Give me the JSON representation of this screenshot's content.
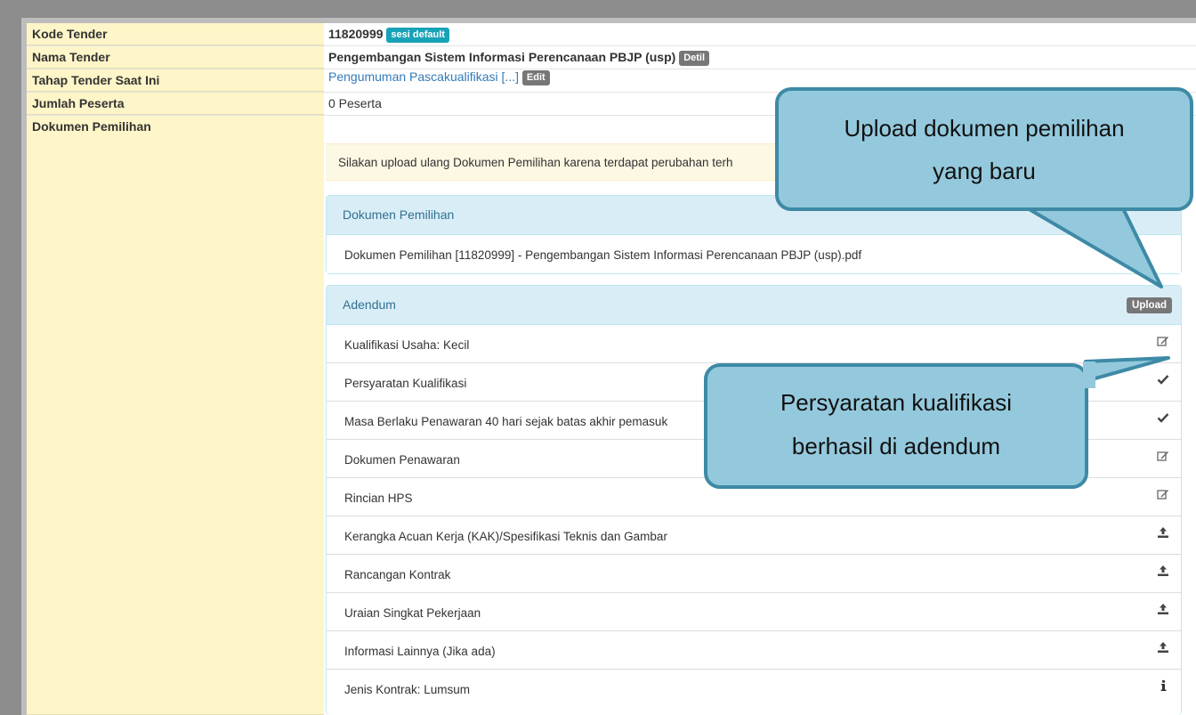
{
  "fields": {
    "kode_label": "Kode Tender",
    "kode_value": "11820999",
    "kode_badge": "sesi default",
    "nama_label": "Nama Tender",
    "nama_value": "Pengembangan Sistem Informasi Perencanaan PBJP (usp)",
    "nama_badge": "Detil",
    "tahap_label": "Tahap Tender Saat Ini",
    "tahap_value": "Pengumuman Pascakualifikasi [...]",
    "tahap_badge": "Edit",
    "jumlah_label": "Jumlah Peserta",
    "jumlah_value": "0 Peserta",
    "dokumen_label": "Dokumen Pemilihan"
  },
  "alert": "Silakan upload ulang Dokumen Pemilihan karena terdapat perubahan terh",
  "panel_dokumen": {
    "title": "Dokumen Pemilihan",
    "file": "Dokumen Pemilihan [11820999] - Pengembangan Sistem Informasi Perencanaan PBJP (usp).pdf"
  },
  "panel_adendum": {
    "title": "Adendum",
    "upload_label": "Upload",
    "items": [
      {
        "label": "Kualifikasi Usaha: Kecil",
        "icon": "edit-icon"
      },
      {
        "label": "Persyaratan Kualifikasi",
        "icon": "check-icon"
      },
      {
        "label": "Masa Berlaku Penawaran 40 hari sejak batas akhir pemasuk",
        "icon": "check-icon"
      },
      {
        "label": "Dokumen Penawaran",
        "icon": "edit-icon"
      },
      {
        "label": "Rincian HPS",
        "icon": "edit-icon"
      },
      {
        "label": "Kerangka Acuan Kerja (KAK)/Spesifikasi Teknis dan Gambar",
        "icon": "upload-icon"
      },
      {
        "label": "Rancangan Kontrak",
        "icon": "upload-icon"
      },
      {
        "label": "Uraian Singkat Pekerjaan",
        "icon": "upload-icon"
      },
      {
        "label": "Informasi Lainnya (Jika ada)",
        "icon": "upload-icon"
      },
      {
        "label": "Jenis Kontrak: Lumsum",
        "icon": "info-icon"
      }
    ]
  },
  "callouts": {
    "upload_line1": "Upload dokumen pemilihan",
    "upload_line2": "yang baru",
    "persyaratan_line1": "Persyaratan kualifikasi",
    "persyaratan_line2": "berhasil di adendum"
  }
}
